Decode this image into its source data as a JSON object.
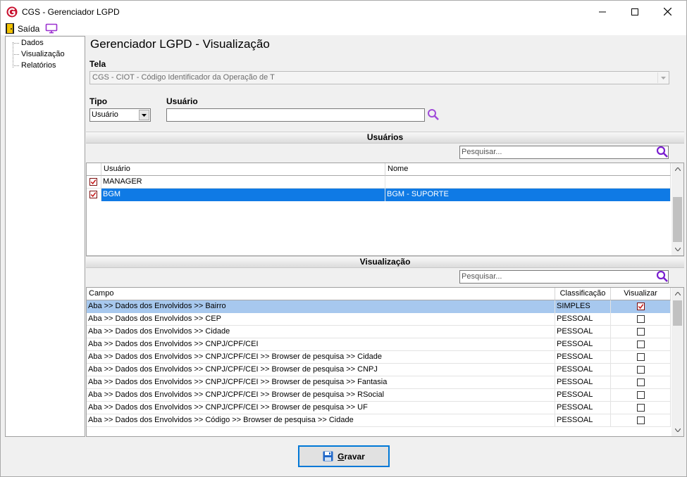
{
  "window": {
    "title": "CGS - Gerenciador LGPD"
  },
  "menubar": {
    "exit_label": "Saída"
  },
  "sidebar": {
    "items": [
      {
        "label": "Dados"
      },
      {
        "label": "Visualização"
      },
      {
        "label": "Relatórios"
      }
    ]
  },
  "page": {
    "title": "Gerenciador LGPD - Visualização"
  },
  "tela": {
    "label": "Tela",
    "value": "CGS - CIOT - Código Identificador da Operação de T"
  },
  "tipo": {
    "label": "Tipo",
    "value": "Usuário"
  },
  "usuario": {
    "label": "Usuário",
    "value": ""
  },
  "usuarios_section": {
    "title": "Usuários",
    "search_placeholder": "Pesquisar...",
    "columns": [
      "Usuário",
      "Nome"
    ],
    "rows": [
      {
        "checked": true,
        "usuario": "MANAGER",
        "nome": ""
      },
      {
        "checked": true,
        "usuario": "BGM",
        "nome": "BGM - SUPORTE"
      }
    ]
  },
  "visualizacao_section": {
    "title": "Visualização",
    "search_placeholder": "Pesquisar...",
    "columns": [
      "Campo",
      "Classificação",
      "Visualizar"
    ],
    "rows": [
      {
        "campo": "Aba >> Dados dos Envolvidos >> Bairro",
        "classificacao": "SIMPLES",
        "visualizar": true
      },
      {
        "campo": "Aba >> Dados dos Envolvidos >> CEP",
        "classificacao": "PESSOAL",
        "visualizar": false
      },
      {
        "campo": "Aba >> Dados dos Envolvidos >> Cidade",
        "classificacao": "PESSOAL",
        "visualizar": false
      },
      {
        "campo": "Aba >> Dados dos Envolvidos >> CNPJ/CPF/CEI",
        "classificacao": "PESSOAL",
        "visualizar": false
      },
      {
        "campo": "Aba >> Dados dos Envolvidos >> CNPJ/CPF/CEI >> Browser de pesquisa >> Cidade",
        "classificacao": "PESSOAL",
        "visualizar": false
      },
      {
        "campo": "Aba >> Dados dos Envolvidos >> CNPJ/CPF/CEI >> Browser de pesquisa >> CNPJ",
        "classificacao": "PESSOAL",
        "visualizar": false
      },
      {
        "campo": "Aba >> Dados dos Envolvidos >> CNPJ/CPF/CEI >> Browser de pesquisa >> Fantasia",
        "classificacao": "PESSOAL",
        "visualizar": false
      },
      {
        "campo": "Aba >> Dados dos Envolvidos >> CNPJ/CPF/CEI >> Browser de pesquisa >> RSocial",
        "classificacao": "PESSOAL",
        "visualizar": false
      },
      {
        "campo": "Aba >> Dados dos Envolvidos >> CNPJ/CPF/CEI >> Browser de pesquisa >> UF",
        "classificacao": "PESSOAL",
        "visualizar": false
      },
      {
        "campo": "Aba >> Dados dos Envolvidos >> Código >> Browser de pesquisa >> Cidade",
        "classificacao": "PESSOAL",
        "visualizar": false
      }
    ]
  },
  "footer": {
    "save_label": "Gravar"
  },
  "colors": {
    "accent": "#0078d7",
    "selection": "#0f7ae5",
    "selection_light": "#a7c8ee",
    "logo": "#c8102e",
    "icon_purple": "#9b30d0"
  }
}
